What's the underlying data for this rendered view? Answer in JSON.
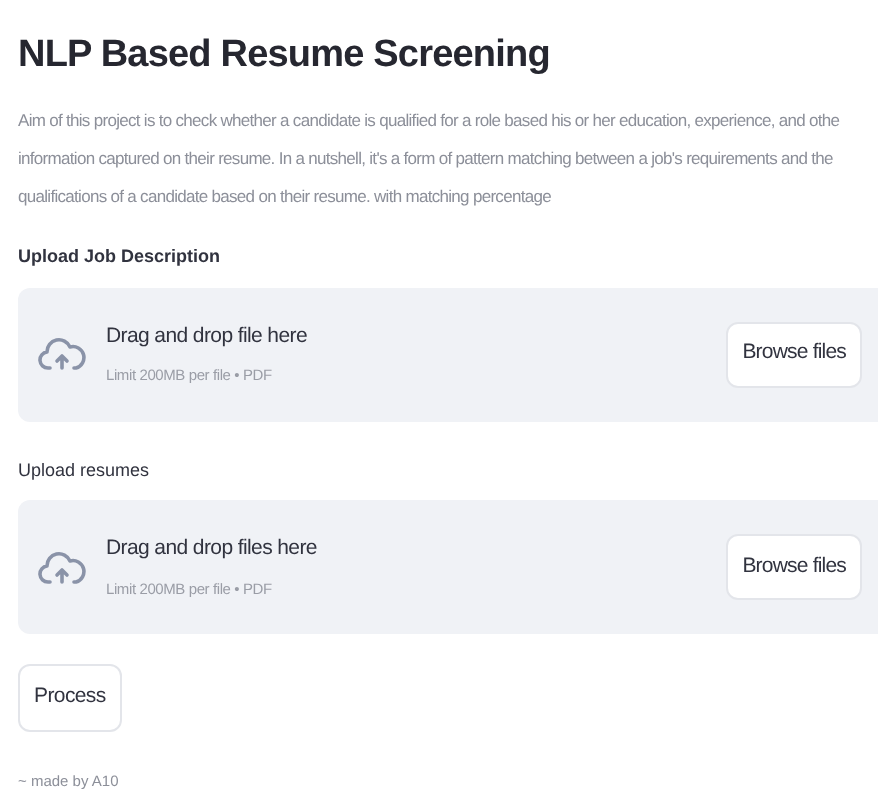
{
  "title": "NLP Based Resume Screening",
  "description_lines": [
    "Aim of this project is to check whether a candidate is qualified for a role based his or her education, experience, and othe",
    "information captured on their resume. In a nutshell, it's a form of pattern matching between a job's requirements and the",
    "qualifications of a candidate based on their resume. with matching percentage"
  ],
  "uploaders": [
    {
      "label": "Upload Job Description",
      "drop_text": "Drag and drop file here",
      "limit_text": "Limit 200MB per file • PDF",
      "button": "Browse files"
    },
    {
      "label": "Upload resumes",
      "drop_text": "Drag and drop files here",
      "limit_text": "Limit 200MB per file • PDF",
      "button": "Browse files"
    }
  ],
  "process_button": "Process",
  "footer": "~ made by A10"
}
